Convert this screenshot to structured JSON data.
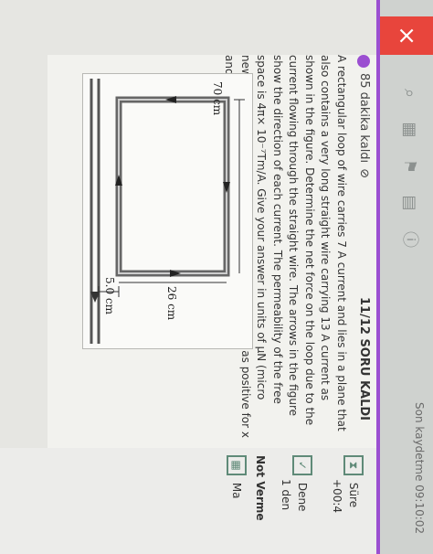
{
  "window": {
    "close_icon": "×",
    "saved_label": "Son kaydetme 09:10:02"
  },
  "header": {
    "timer_label": "85 dakika kaldı",
    "question_counter": "11/12 SORU KALDI"
  },
  "question": {
    "text": "A rectangular loop of wire carries 7 A current and lies in a plane that also contains a very long straight wire carrying 13 A current as shown in the figure. Determine the net force on the loop due to the current flowing through the straight wire. The arrows in the figure show the direction of each current. The permeability of the free space is 4π× 10⁻⁷Tm/A. Give your answer in units of μN (micro newton). Take the direction to the right and to the up as positive for x and y coordinates."
  },
  "figure": {
    "label_distance": "5.0 cm",
    "label_width": "26 cm",
    "label_height": "70 cm"
  },
  "side_panel": {
    "sure_label": "Süre",
    "sure_value": "+00:4",
    "dene_label": "Dene",
    "dene_value": "1 den",
    "not_label": "Not Verme",
    "ma_label": "Ma"
  }
}
